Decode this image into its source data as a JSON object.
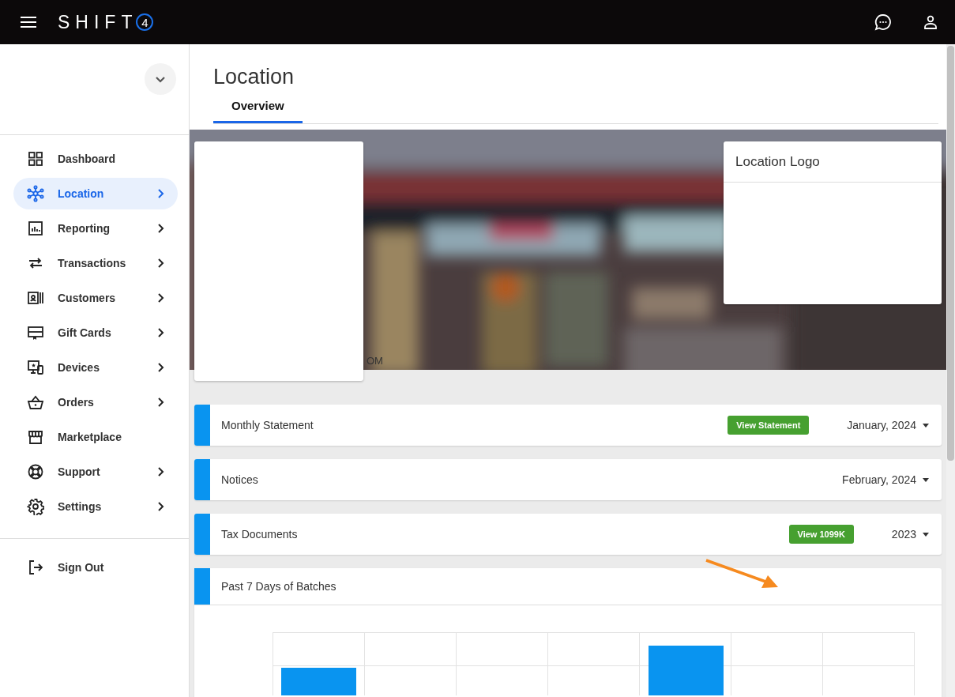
{
  "topbar": {
    "logo": {
      "text": "SHIFT",
      "badge": "4"
    }
  },
  "sidebar": {
    "items": [
      {
        "label": "Dashboard",
        "selected": false,
        "has_submenu": false
      },
      {
        "label": "Location",
        "selected": true,
        "has_submenu": true
      },
      {
        "label": "Reporting",
        "selected": false,
        "has_submenu": true
      },
      {
        "label": "Transactions",
        "selected": false,
        "has_submenu": true
      },
      {
        "label": "Customers",
        "selected": false,
        "has_submenu": true
      },
      {
        "label": "Gift Cards",
        "selected": false,
        "has_submenu": true
      },
      {
        "label": "Devices",
        "selected": false,
        "has_submenu": true
      },
      {
        "label": "Orders",
        "selected": false,
        "has_submenu": true
      },
      {
        "label": "Marketplace",
        "selected": false,
        "has_submenu": false
      },
      {
        "label": "Support",
        "selected": false,
        "has_submenu": true
      },
      {
        "label": "Settings",
        "selected": false,
        "has_submenu": true
      }
    ],
    "sign_out": "Sign Out"
  },
  "page": {
    "title": "Location",
    "tabs": [
      {
        "label": "Overview",
        "selected": true
      }
    ]
  },
  "banner": {
    "partial_text": "OM",
    "logo_card": {
      "title": "Location Logo"
    }
  },
  "panels": [
    {
      "title": "Monthly Statement",
      "button": "View Statement",
      "dropdown": "January, 2024"
    },
    {
      "title": "Notices",
      "dropdown": "February, 2024"
    },
    {
      "title": "Tax Documents",
      "button": "View 1099K",
      "dropdown": "2023"
    }
  ],
  "chart_panel": {
    "title": "Past 7 Days of Batches"
  }
}
